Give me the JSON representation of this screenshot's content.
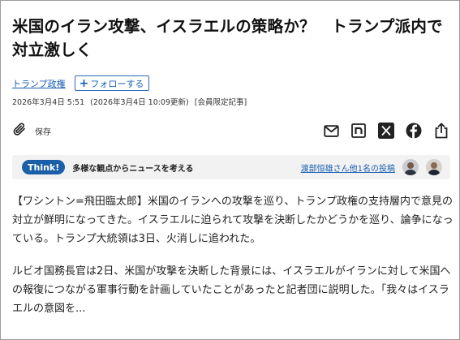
{
  "article": {
    "title": "米国のイラン攻撃、イスラエルの策略か？　トランプ派内で対立激しく",
    "topic_link": "トランプ政権",
    "follow_label": "フォローする",
    "date": "2026年3月4日 5:51",
    "updated": "(2026年3月4日 10:09更新)",
    "members_only": "[会員限定記事]",
    "save_label": "保存",
    "paragraph1": "【ワシントン=飛田臨太郎】米国のイランへの攻撃を巡り、トランプ政権の支持層内で意見の対立が鮮明になってきた。イスラエルに迫られて攻撃を決断したかどうかを巡り、論争になっている。トランプ大統領は3日、火消しに追われた。",
    "paragraph2": "ルビオ国務長官は2日、米国が攻撃を決断した背景には、イスラエルがイランに対して米国への報復につながる軍事行動を計画していたことがあったと記者団に説明した。「我々はイスラエルの意図を..."
  },
  "think": {
    "badge": "Think!",
    "description": "多様な観点からニュースを考える",
    "contributors_link": "渡部恒雄さん他1名の投稿"
  },
  "icons": {
    "save": "paperclip-icon",
    "mail": "mail-icon",
    "note": "note-icon",
    "x": "x-icon",
    "facebook": "facebook-icon",
    "share": "share-icon"
  },
  "colors": {
    "link": "#1a5fb4",
    "think_badge": "#1b5fa8",
    "think_bar": "#f2f2f2"
  }
}
